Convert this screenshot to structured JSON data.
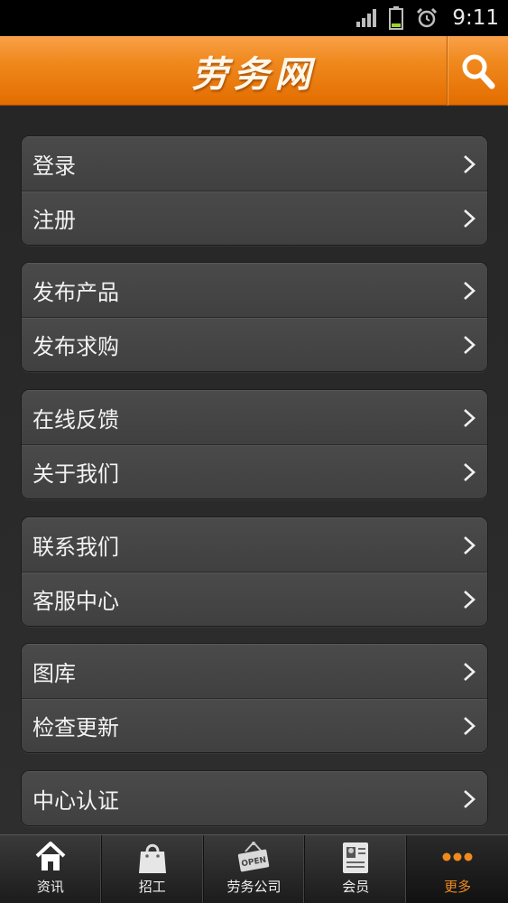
{
  "status_bar": {
    "time": "9:11",
    "icons": [
      "signal-icon",
      "battery-icon",
      "alarm-icon"
    ]
  },
  "header": {
    "title": "劳务网",
    "search_icon": "search-icon",
    "accent_color": "#f08a1f"
  },
  "menu": {
    "groups": [
      {
        "items": [
          {
            "label": "登录"
          },
          {
            "label": "注册"
          }
        ]
      },
      {
        "items": [
          {
            "label": "发布产品"
          },
          {
            "label": "发布求购"
          }
        ]
      },
      {
        "items": [
          {
            "label": "在线反馈"
          },
          {
            "label": "关于我们"
          }
        ]
      },
      {
        "items": [
          {
            "label": "联系我们"
          },
          {
            "label": "客服中心"
          }
        ]
      },
      {
        "items": [
          {
            "label": "图库"
          },
          {
            "label": "检查更新"
          }
        ]
      },
      {
        "items": [
          {
            "label": "中心认证"
          }
        ]
      }
    ]
  },
  "bottom_nav": {
    "tabs": [
      {
        "label": "资讯",
        "icon": "home-icon"
      },
      {
        "label": "招工",
        "icon": "shopping-bag-icon"
      },
      {
        "label": "劳务公司",
        "icon": "open-sign-icon"
      },
      {
        "label": "会员",
        "icon": "member-card-icon"
      },
      {
        "label": "更多",
        "icon": "more-dots-icon",
        "active": true
      }
    ]
  }
}
